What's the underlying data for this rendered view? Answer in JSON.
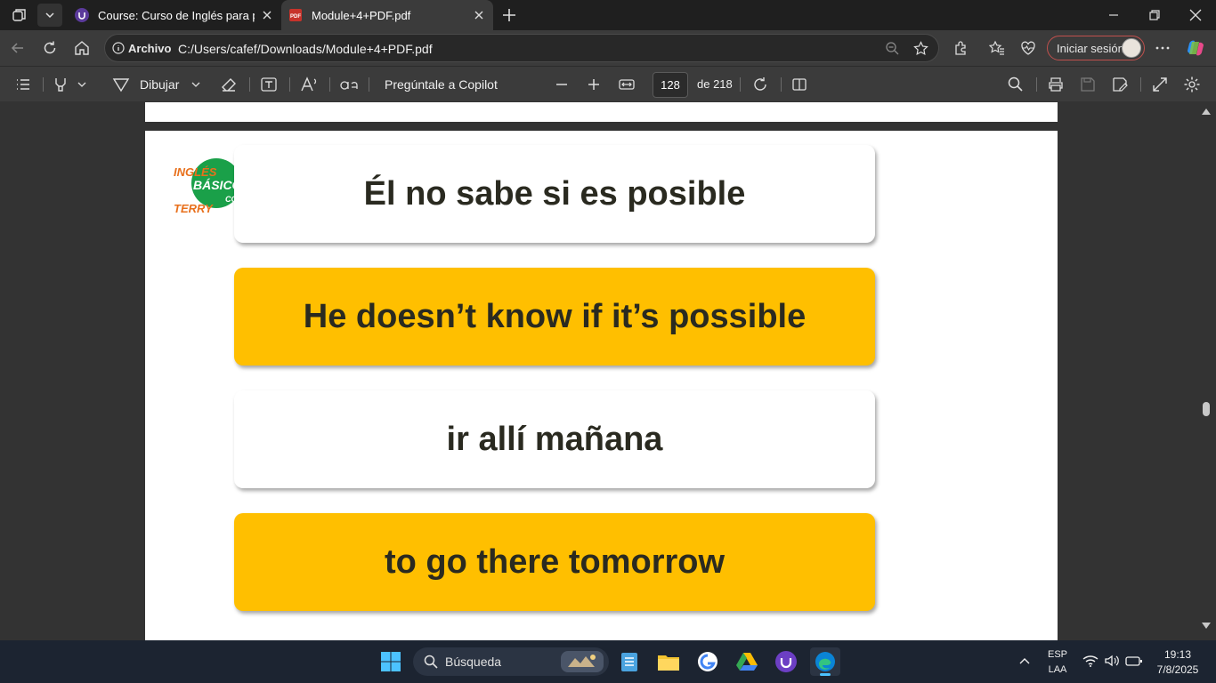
{
  "browser": {
    "tabs": [
      {
        "title": "Course: Curso de Inglés para principiantes",
        "active": false
      },
      {
        "title": "Module+4+PDF.pdf",
        "active": true
      }
    ],
    "address": {
      "label": "Archivo",
      "url": "C:/Users/cafef/Downloads/Module+4+PDF.pdf"
    },
    "signin_label": "Iniciar sesión"
  },
  "pdf_toolbar": {
    "draw_label": "Dibujar",
    "copilot_label": "Pregúntale a Copilot",
    "page_number": "128",
    "page_total": "de 218"
  },
  "pdf_page": {
    "logo": {
      "line1": "INGLÉS",
      "line2": "BÁSICO",
      "line3": "TERRY",
      "suffix": "CO"
    },
    "cards": [
      {
        "text": "Él no sabe si es posible",
        "style": "white"
      },
      {
        "text": "He doesn’t know if it’s possible",
        "style": "yellow"
      },
      {
        "text": "ir allí mañana",
        "style": "white"
      },
      {
        "text": "to go there tomorrow",
        "style": "yellow"
      }
    ]
  },
  "taskbar": {
    "search_placeholder": "Búsqueda",
    "language": "ESP",
    "layout": "LAA",
    "time": "19:13",
    "date": "7/8/2025"
  },
  "colors": {
    "card_yellow": "#ffbf00",
    "signin_border": "#c0504d",
    "edge_blue": "#0a84d6"
  }
}
